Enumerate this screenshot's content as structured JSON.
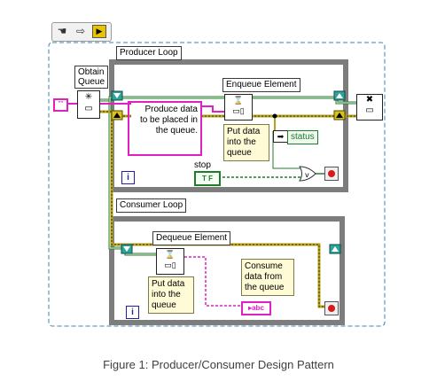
{
  "toolbar": {
    "tools": [
      "hand-tool-icon",
      "arrow-right-icon",
      "run-highlight-icon"
    ]
  },
  "producer": {
    "loop_label": "Producer Loop",
    "obtain_queue": "Obtain\nQueue",
    "enqueue_label": "Enqueue Element",
    "produce_note": "Produce data\nto be placed in\nthe queue.",
    "put_note": "Put data\ninto the\nqueue",
    "status_label": "status",
    "stop_label": "stop",
    "stop_value": "T F",
    "iteration": "i"
  },
  "consumer": {
    "loop_label": "Consumer Loop",
    "dequeue_label": "Dequeue Element",
    "put_note": "Put data\ninto the\nqueue",
    "consume_note": "Consume\ndata from\nthe queue",
    "abc_indicator": "abc",
    "iteration": "i"
  },
  "caption": "Figure 1: Producer/Consumer Design Pattern",
  "colors": {
    "loop_frame": "#7d7d7d",
    "queue_wire": "#2e7d32",
    "error_wire": "#b5a21a",
    "string_wire": "#e020c0",
    "bool_wire": "#1f7d2a",
    "stop_button": "#d41c1c"
  }
}
